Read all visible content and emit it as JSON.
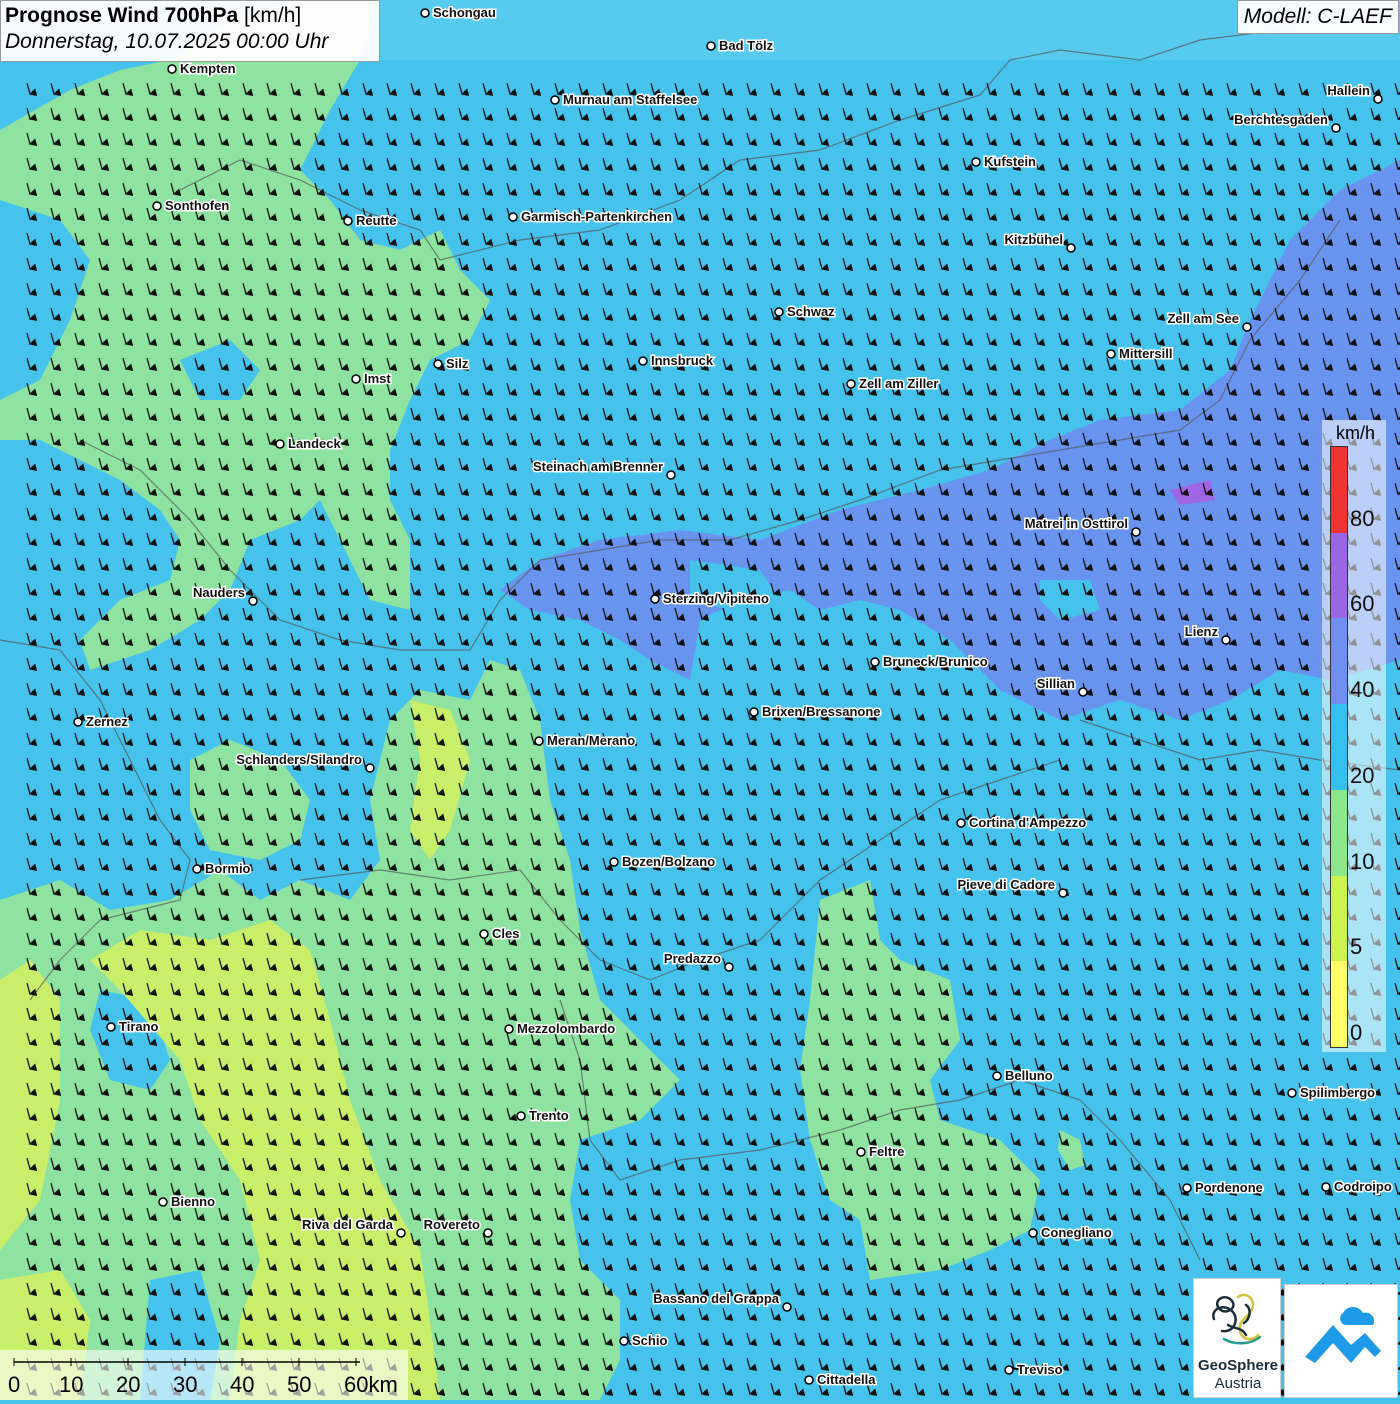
{
  "header": {
    "title_bold": "Prognose Wind 700hPa",
    "title_unit": " [km/h]",
    "datetime": "Donnerstag, 10.07.2025 00:00 Uhr",
    "model": "Modell: C-LAEF"
  },
  "legend": {
    "unit": "km/h",
    "bands": [
      {
        "from": 0,
        "to": 5,
        "color": "#ffff66"
      },
      {
        "from": 5,
        "to": 10,
        "color": "#ccf24d"
      },
      {
        "from": 10,
        "to": 20,
        "color": "#8ce68c"
      },
      {
        "from": 20,
        "to": 40,
        "color": "#33c0ee"
      },
      {
        "from": 40,
        "to": 60,
        "color": "#6f8ff0"
      },
      {
        "from": 60,
        "to": 80,
        "color": "#9966e6"
      },
      {
        "from": 80,
        "to": 100,
        "color": "#f03333"
      }
    ],
    "tick_labels": [
      "0",
      "5",
      "10",
      "20",
      "40",
      "60",
      "80"
    ]
  },
  "scale": {
    "labels": [
      "0",
      "10",
      "20",
      "30",
      "40",
      "50",
      "60km"
    ]
  },
  "logos": {
    "geosphere_line1": "GeoSphere",
    "geosphere_line2": "Austria"
  },
  "wind": {
    "arrow_direction": "south (wind from north)",
    "region_levels": {
      "background": "20-40 km/h",
      "west_and_southwest": "10-20 km/h",
      "far_southwest": "5-10 km/h",
      "east_alpine_belt": "40-60 km/h",
      "small_core": "60-80 km/h"
    }
  },
  "cities": [
    {
      "name": "Schongau",
      "side": "r"
    },
    {
      "name": "Kempten",
      "side": "r"
    },
    {
      "name": "Bad Tölz",
      "side": "r"
    },
    {
      "name": "Murnau am Staffelsee",
      "side": "r"
    },
    {
      "name": "Hallein",
      "side": "l"
    },
    {
      "name": "Berchtesgaden",
      "side": "l"
    },
    {
      "name": "Kufstein",
      "side": "r"
    },
    {
      "name": "Sonthofen",
      "side": "r"
    },
    {
      "name": "Reutte",
      "side": "r"
    },
    {
      "name": "Garmisch-Partenkirchen",
      "side": "r"
    },
    {
      "name": "Kitzbühel",
      "side": "l"
    },
    {
      "name": "Schwaz",
      "side": "r"
    },
    {
      "name": "Zell am See",
      "side": "l"
    },
    {
      "name": "Innsbruck",
      "side": "r"
    },
    {
      "name": "Silz",
      "side": "r"
    },
    {
      "name": "Imst",
      "side": "r"
    },
    {
      "name": "Mittersill",
      "side": "r"
    },
    {
      "name": "Zell am Ziller",
      "side": "r"
    },
    {
      "name": "Landeck",
      "side": "r"
    },
    {
      "name": "Steinach am Brenner",
      "side": "l"
    },
    {
      "name": "Matrei in Osttirol",
      "side": "l"
    },
    {
      "name": "Nauders",
      "side": "l"
    },
    {
      "name": "Sterzing/Vipiteno",
      "side": "r"
    },
    {
      "name": "Lienz",
      "side": "l"
    },
    {
      "name": "Bruneck/Brunico",
      "side": "r"
    },
    {
      "name": "Sillian",
      "side": "l"
    },
    {
      "name": "Brixen/Bressanone",
      "side": "r"
    },
    {
      "name": "Zernez",
      "side": "r"
    },
    {
      "name": "Meran/Merano",
      "side": "r"
    },
    {
      "name": "Schlanders/Silandro",
      "side": "l"
    },
    {
      "name": "Cortina d'Ampezzo",
      "side": "r"
    },
    {
      "name": "Bozen/Bolzano",
      "side": "r"
    },
    {
      "name": "Bormio",
      "side": "r"
    },
    {
      "name": "Pieve di Cadore",
      "side": "l"
    },
    {
      "name": "Cles",
      "side": "r"
    },
    {
      "name": "Predazzo",
      "side": "l"
    },
    {
      "name": "Tirano",
      "side": "r"
    },
    {
      "name": "Mezzolombardo",
      "side": "r"
    },
    {
      "name": "Belluno",
      "side": "r"
    },
    {
      "name": "Spilimbergo",
      "side": "r"
    },
    {
      "name": "Trento",
      "side": "r"
    },
    {
      "name": "Feltre",
      "side": "r"
    },
    {
      "name": "Pordenone",
      "side": "r"
    },
    {
      "name": "Codroipo",
      "side": "r"
    },
    {
      "name": "Bienno",
      "side": "r"
    },
    {
      "name": "Riva del Garda",
      "side": "l"
    },
    {
      "name": "Rovereto",
      "side": "l"
    },
    {
      "name": "Conegliano",
      "side": "r"
    },
    {
      "name": "Bassano del Grappa",
      "side": "l"
    },
    {
      "name": "Schio",
      "side": "r"
    },
    {
      "name": "Treviso",
      "side": "r"
    },
    {
      "name": "Cittadella",
      "side": "r"
    }
  ]
}
